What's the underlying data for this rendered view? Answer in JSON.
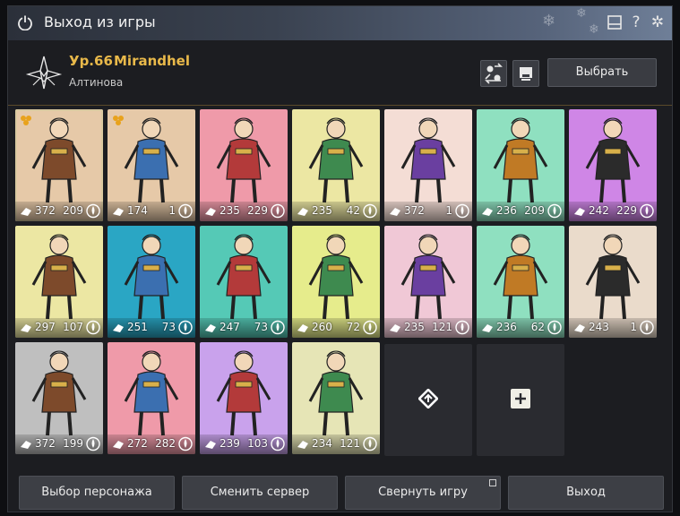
{
  "window": {
    "title": "Выход из игры"
  },
  "character": {
    "level": "Ур.66",
    "name": "Mirandhel",
    "server": "Алтинова"
  },
  "header_buttons": {
    "select_label": "Выбрать"
  },
  "cards": [
    {
      "bg": "#e6c9a8",
      "v1": "372",
      "v2": "209",
      "badge": "star"
    },
    {
      "bg": "#e6c9a8",
      "v1": "174",
      "v2": "1",
      "badge": "star"
    },
    {
      "bg": "#ef9aa9",
      "v1": "235",
      "v2": "229",
      "badge": ""
    },
    {
      "bg": "#ece7a3",
      "v1": "235",
      "v2": "42",
      "badge": ""
    },
    {
      "bg": "#f4ddd5",
      "v1": "372",
      "v2": "1",
      "badge": ""
    },
    {
      "bg": "#8fe0c0",
      "v1": "236",
      "v2": "209",
      "badge": ""
    },
    {
      "bg": "#cf86e6",
      "v1": "242",
      "v2": "229",
      "badge": ""
    },
    {
      "bg": "#ece7a3",
      "v1": "297",
      "v2": "107",
      "badge": ""
    },
    {
      "bg": "#2aa6c4",
      "v1": "251",
      "v2": "73",
      "badge": ""
    },
    {
      "bg": "#55c9b6",
      "v1": "247",
      "v2": "73",
      "badge": ""
    },
    {
      "bg": "#e6ec8c",
      "v1": "260",
      "v2": "72",
      "badge": ""
    },
    {
      "bg": "#f0c8d6",
      "v1": "235",
      "v2": "121",
      "badge": ""
    },
    {
      "bg": "#8fe0c0",
      "v1": "236",
      "v2": "62",
      "badge": ""
    },
    {
      "bg": "#eadbcb",
      "v1": "243",
      "v2": "1",
      "badge": ""
    },
    {
      "bg": "#bfbfbf",
      "v1": "372",
      "v2": "199",
      "badge": ""
    },
    {
      "bg": "#ef9aa9",
      "v1": "272",
      "v2": "282",
      "badge": ""
    },
    {
      "bg": "#c9a2ec",
      "v1": "239",
      "v2": "103",
      "badge": ""
    },
    {
      "bg": "#e6e5b6",
      "v1": "234",
      "v2": "121",
      "badge": ""
    }
  ],
  "footer": {
    "character_select": "Выбор персонажа",
    "change_server": "Сменить сервер",
    "minimize": "Свернуть игру",
    "exit": "Выход"
  },
  "icons": {
    "power": "power-icon",
    "minimize_window": "tray-icon",
    "help": "question-icon",
    "settings": "snowflake-settings-icon",
    "swap": "swap-characters-icon",
    "inventory": "inventory-icon",
    "add_slot": "plus-icon",
    "empty_slot": "diamond-arrow-icon"
  }
}
